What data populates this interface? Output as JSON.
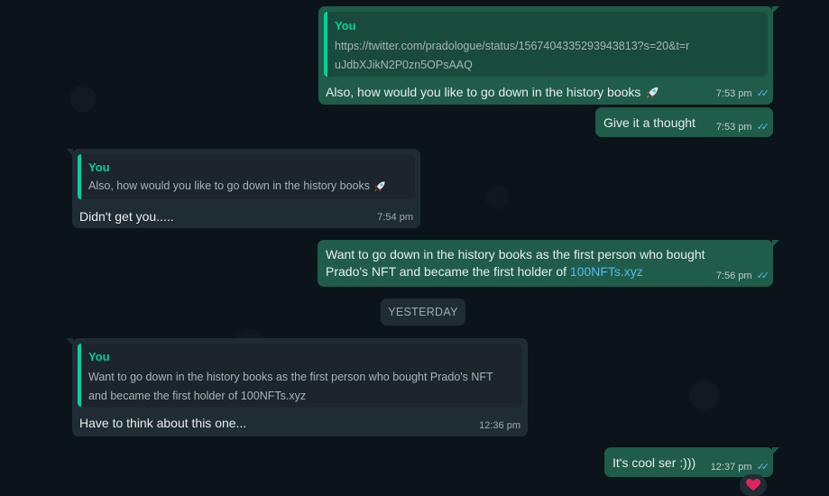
{
  "messages": {
    "m1": {
      "quote_author": "You",
      "quote_text": "https://twitter.com/pradologue/status/1567404335293943813?s=20&t=ruJdbXJikN2P0zn5OPsAAQ",
      "text": "Also, how would you like to go down in the history books",
      "emoji": "rocket-icon",
      "time": "7:53 pm"
    },
    "m2": {
      "text": "Give it a thought",
      "time": "7:53 pm"
    },
    "m3": {
      "quote_author": "You",
      "quote_text": "Also, how would you like to go down in the history books",
      "quote_emoji": "rocket-icon",
      "text": "Didn't get you.....",
      "time": "7:54 pm"
    },
    "m4": {
      "text_prefix": "Want to go down in the history books as the first person who bought Prado's NFT and became the first holder of",
      "link": "100NFTs.xyz",
      "time": "7:56 pm"
    },
    "date_divider": "YESTERDAY",
    "m5": {
      "quote_author": "You",
      "quote_text": "Want to go down in the history books as the first person who bought Prado's NFT and became the first holder of 100NFTs.xyz",
      "text": "Have to think about this one...",
      "time": "12:36 pm"
    },
    "m6": {
      "text": "It's cool ser :)))",
      "time": "12:37 pm",
      "reaction": "❤️"
    }
  },
  "colors": {
    "background": "#0b141a",
    "outgoing_bubble": "#1f5c4a",
    "incoming_bubble": "#202c33",
    "quote_accent": "#06cf9c",
    "read_ticks": "#53bdeb"
  }
}
